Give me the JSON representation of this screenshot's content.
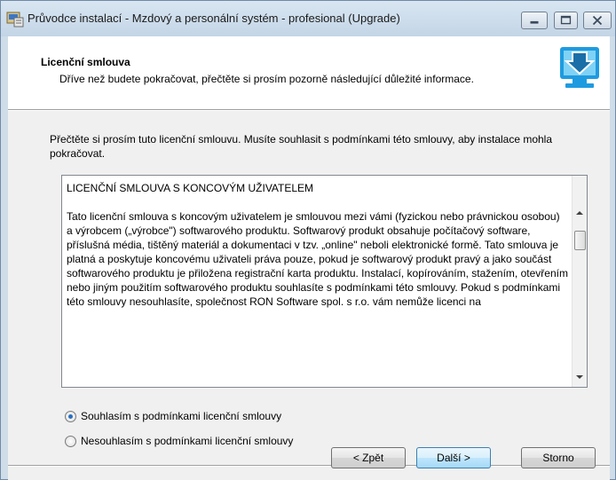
{
  "window": {
    "title": "Průvodce instalací - Mzdový a personální systém - profesional (Upgrade)"
  },
  "icons": {
    "app": "installer-icon",
    "minimize": "minimize-icon",
    "maximize": "maximize-icon",
    "close": "close-icon",
    "header_logo": "computer-download-icon"
  },
  "header": {
    "title": "Licenční smlouva",
    "subtitle": "Dříve než budete pokračovat, přečtěte si prosím pozorně následující důležité informace."
  },
  "intro": "Přečtěte si prosím tuto licenční smlouvu. Musíte souhlasit s podmínkami této smlouvy, aby instalace mohla pokračovat.",
  "license": {
    "title": "LICENČNÍ SMLOUVA S KONCOVÝM UŽIVATELEM",
    "body": "Tato licenční smlouva s koncovým uživatelem je smlouvou mezi vámi (fyzickou nebo právnickou osobou) a výrobcem („výrobce\") softwarového produktu. Softwarový produkt obsahuje počítačový software, příslušná média, tištěný materiál a dokumentaci v tzv. „online\" neboli elektronické formě. Tato smlouva je platná a poskytuje koncovému uživateli práva pouze, pokud je softwarový produkt pravý a jako součást softwarového produktu je přiložena registrační karta produktu. Instalací, kopírováním, stažením, otevřením nebo jiným použitím softwarového produktu souhlasíte s podmínkami této smlouvy. Pokud s podmínkami této smlouvy nesouhlasíte, společnost RON Software spol. s r.o. vám nemůže licenci na"
  },
  "options": {
    "accept": "Souhlasím s podmínkami licenční smlouvy",
    "decline": "Nesouhlasím s podmínkami licenční smlouvy",
    "selected": "accept"
  },
  "buttons": {
    "back": "< Zpět",
    "next": "Další >",
    "cancel": "Storno"
  },
  "colors": {
    "accent": "#2a6fbf",
    "logo_blue": "#1e9be0"
  }
}
